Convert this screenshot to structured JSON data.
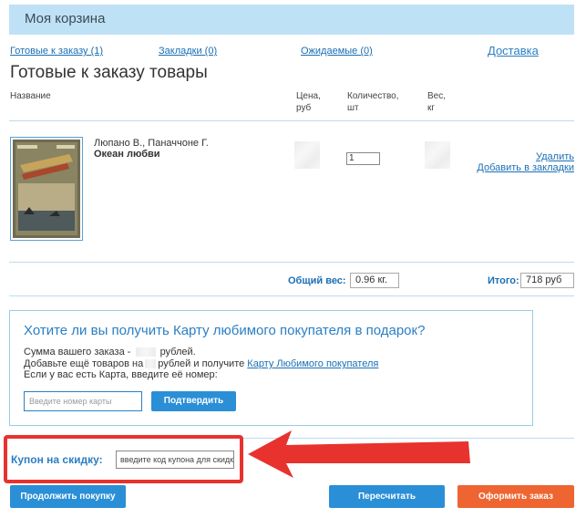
{
  "header": {
    "title": "Моя корзина"
  },
  "tabs": [
    {
      "label": "Готовые к заказу (1)"
    },
    {
      "label": "Закладки (0)"
    },
    {
      "label": "Ожидаемые (0)"
    },
    {
      "label": "Доставка"
    }
  ],
  "section": {
    "title": "Готовые к заказу товары"
  },
  "columns": {
    "name": "Название",
    "price_1": "Цена,",
    "price_2": "руб",
    "qty_1": "Количество,",
    "qty_2": "шт",
    "weight_1": "Вес,",
    "weight_2": "кг"
  },
  "item": {
    "author": "Люпано В., Паначчоне Г.",
    "title": "Океан любви",
    "quantity": "1",
    "remove_label": "Удалить",
    "bookmark_label": "Добавить в закладки"
  },
  "totals": {
    "weight_label": "Общий вес:",
    "weight_value": "0.96 кг.",
    "total_label": "Итого:",
    "total_value": "718 руб"
  },
  "card_offer": {
    "title": "Хотите ли вы получить Карту любимого покупателя в подарок?",
    "line1_a": "Сумма вашего заказа -",
    "line1_b": "рублей.",
    "line2_a": "Добавьте ещё товаров на",
    "line2_b": "рублей и получите",
    "line2_link": "Карту Любимого покупателя",
    "line3": "Если у вас есть Карта, введите её номер:",
    "input_placeholder": "Введите номер карты",
    "confirm_label": "Подтвердить"
  },
  "coupon": {
    "label": "Купон на скидку:",
    "placeholder": "введите код купона для скидки"
  },
  "buttons": {
    "continue_label": "Продолжить покупку",
    "recalc_label": "Пересчитать",
    "checkout_label": "Оформить заказ"
  },
  "colors": {
    "header_bg": "#bfe1f6",
    "link": "#1a6fb5",
    "button_blue": "#2a8fd6",
    "button_orange": "#ee6532",
    "annotation_red": "#e7322e"
  }
}
